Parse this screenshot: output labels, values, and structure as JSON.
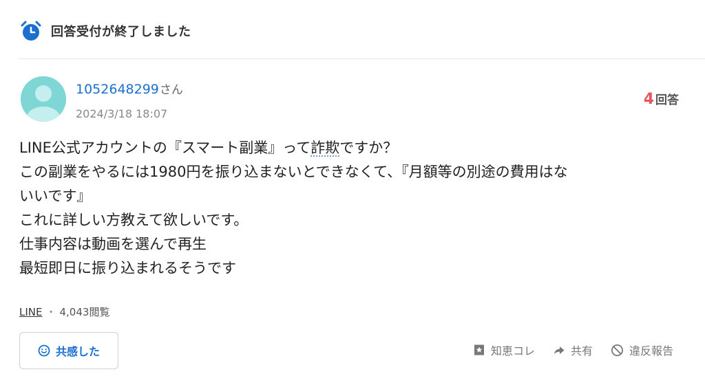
{
  "header": {
    "title": "回答受付が終了しました",
    "icon": "alarm-clock-icon"
  },
  "user": {
    "name": "1052648299",
    "suffix": "さん",
    "date": "2024/3/18 18:07",
    "avatar_color": "#7ed7d5"
  },
  "answers": {
    "count": "4",
    "unit": "回答",
    "count_color": "#e8565c"
  },
  "question": {
    "lines": [
      {
        "pre": "LINE公式アカウントの『スマート副業』って",
        "dotted": "詐欺",
        "post": "ですか？"
      },
      {
        "text": "この副業をやるには1980円を振り込まないとできなくて、『月額等の別途の費用はな"
      },
      {
        "text": "いいです』"
      },
      {
        "text": "これに詳しい方教えて欲しいです。"
      },
      {
        "text": "仕事内容は動画を選んで再生"
      },
      {
        "text": "最短即日に振り込まれるそうです"
      }
    ]
  },
  "meta": {
    "tag": "LINE",
    "separator": "・",
    "views": "4,043閲覧"
  },
  "actions": {
    "empathy_label": "共感した",
    "chiebukuro_label": "知恵コレ",
    "share_label": "共有",
    "report_label": "違反報告"
  },
  "colors": {
    "accent": "#1a6fd1",
    "text": "#222222",
    "muted": "#888888"
  }
}
